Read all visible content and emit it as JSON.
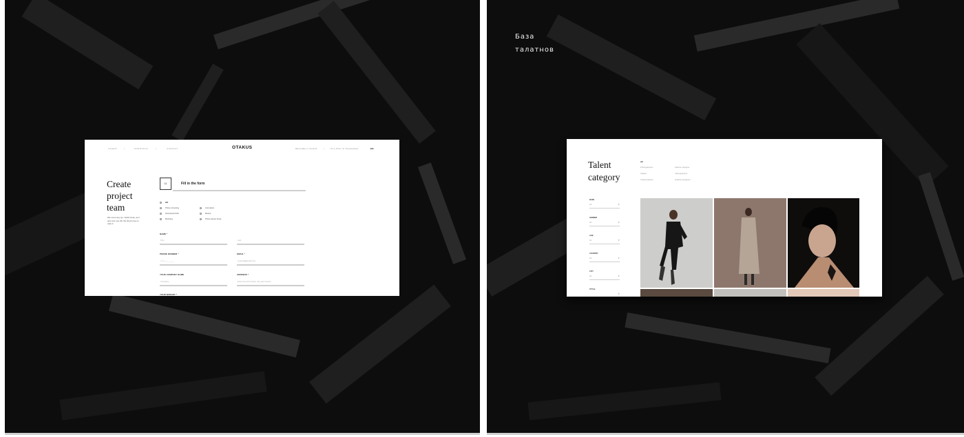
{
  "left_screen": {
    "nav": [
      "TALENT",
      "PORTFOLIO",
      "CONTACT",
      "BECOME A TALENT",
      "I'M A PRO IN TELEGRAM",
      "EN"
    ],
    "logo": "OTAKUS",
    "title": "Create project team",
    "description": "We come dyy tyo. Suttil inmla, yunt and cunt you lrth the ftest hnnys is cwle tt",
    "step_number": "01",
    "step_title": "Fill in the form",
    "services": [
      {
        "label": "All",
        "bold": true
      },
      {
        "label": "Photo shooting",
        "bold": false
      },
      {
        "label": "Storyboard film",
        "bold": false
      },
      {
        "label": "Booking",
        "bold": false
      },
      {
        "label": "Animation",
        "bold": false
      },
      {
        "label": "Books",
        "bold": false
      },
      {
        "label": "Photo about body",
        "bold": false
      }
    ],
    "fields": [
      {
        "label": "NAME *",
        "placeholder": "First"
      },
      {
        "label": "",
        "placeholder": "Last"
      },
      {
        "label": "PHONE NUMBER *",
        "placeholder": "+7 ( ) ___ __ __"
      },
      {
        "label": "EMAIL *",
        "placeholder": "yourmail@gmail.com"
      },
      {
        "label": "YOUR COMPANY NAME",
        "placeholder": "Company"
      },
      {
        "label": "ADDRESS *",
        "placeholder": "Enter here the Postal, City and Country"
      },
      {
        "label": "YOUR BUDGET *",
        "placeholder": ""
      }
    ]
  },
  "right_screen": {
    "overlay_title_line1": "База",
    "overlay_title_line2": "талатнов",
    "title": "Talent category",
    "categories": [
      {
        "label": "All",
        "active": true
      },
      {
        "label": "Photographers",
        "active": false
      },
      {
        "label": "Stylists",
        "active": false
      },
      {
        "label": "Casting talents",
        "active": false
      },
      {
        "label": "Fashion designer",
        "active": false
      },
      {
        "label": "Videographers",
        "active": false
      },
      {
        "label": "Graphic designers",
        "active": false
      }
    ],
    "filters": [
      {
        "label": "BASE",
        "value": "All"
      },
      {
        "label": "GENDER",
        "value": "All"
      },
      {
        "label": "AGE",
        "value": "All"
      },
      {
        "label": "COUNTRY",
        "value": "All"
      },
      {
        "label": "CITY",
        "value": "All"
      },
      {
        "label": "STYLE",
        "value": "All"
      }
    ],
    "photos": [
      "woman in black suit",
      "model in beige coat",
      "portrait with dark hair"
    ]
  },
  "colors": {
    "background": "#0d0d0d",
    "screen": "#ffffff",
    "text": "#111111"
  }
}
